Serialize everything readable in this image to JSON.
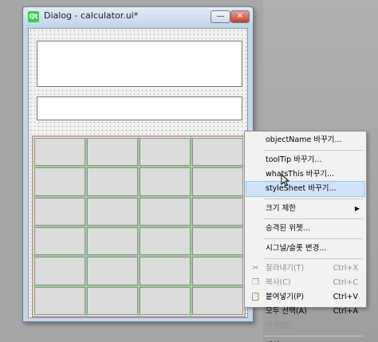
{
  "window": {
    "title": "Dialog - calculator.ui*",
    "app_icon_label": "Qt",
    "minimize_glyph": "—",
    "close_glyph": "✕"
  },
  "button_grid": {
    "rows": 6,
    "columns": 4
  },
  "context_menu": {
    "items": [
      {
        "label": "objectName 바꾸기...",
        "shortcut": "",
        "enabled": true
      },
      {
        "label": "toolTip 바꾸기...",
        "shortcut": "",
        "enabled": true
      },
      {
        "label": "whatsThis 바꾸기...",
        "shortcut": "",
        "enabled": true
      },
      {
        "label": "styleSheet 바꾸기...",
        "shortcut": "",
        "enabled": true,
        "highlighted": true
      },
      {
        "label": "크기 제한",
        "shortcut": "",
        "enabled": true,
        "submenu": true
      },
      {
        "label": "승격된 위젯...",
        "shortcut": "",
        "enabled": true
      },
      {
        "label": "시그널/슬롯 변경...",
        "shortcut": "",
        "enabled": true
      },
      {
        "label": "잘라내기(T)",
        "shortcut": "Ctrl+X",
        "enabled": false,
        "icon": "scissors-icon"
      },
      {
        "label": "복사(C)",
        "shortcut": "Ctrl+C",
        "enabled": false,
        "icon": "copy-icon"
      },
      {
        "label": "붙여넣기(P)",
        "shortcut": "Ctrl+V",
        "enabled": true,
        "icon": "paste-icon"
      },
      {
        "label": "모두 선택(A)",
        "shortcut": "Ctrl+A",
        "enabled": true
      },
      {
        "label": "삭제(D)",
        "shortcut": "",
        "enabled": false
      },
      {
        "label": "배치",
        "shortcut": "",
        "enabled": true,
        "submenu": true
      }
    ],
    "submenu_glyph": "▶"
  },
  "icons": {
    "scissors": "✂",
    "copy": "❐",
    "paste": "📋"
  },
  "colors": {
    "highlight": "#cfe3f7",
    "close_button": "#c4402a",
    "grid_border": "#e0858a"
  }
}
